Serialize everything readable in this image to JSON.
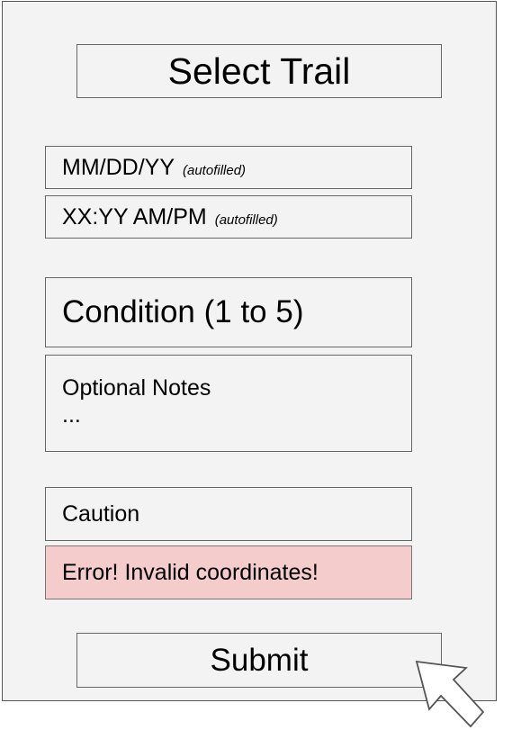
{
  "form": {
    "trail_label": "Select Trail",
    "date": {
      "value": "MM/DD/YY",
      "note": "(autofilled)"
    },
    "time": {
      "value": "XX:YY AM/PM",
      "note": "(autofilled)"
    },
    "condition_label": "Condition (1 to 5)",
    "notes": {
      "label": "Optional Notes",
      "ellipsis": "..."
    },
    "caution_label": "Caution",
    "error_message": "Error! Invalid coordinates!",
    "submit_label": "Submit"
  },
  "colors": {
    "panel_background": "#f3f3f3",
    "error_background": "#f4cccc"
  },
  "icons": {
    "pointer": "mouse-pointer-icon"
  }
}
